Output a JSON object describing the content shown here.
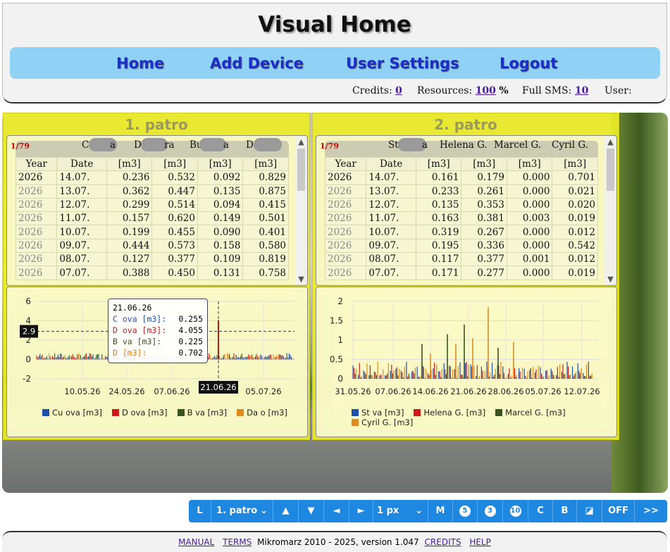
{
  "app_title": "Visual Home",
  "nav": {
    "home": "Home",
    "add_device": "Add Device",
    "user_settings": "User Settings",
    "logout": "Logout"
  },
  "stats": {
    "credits_label": "Credits:",
    "credits": "0",
    "resources_label": "Resources:",
    "resources": "100",
    "resources_unit": "%",
    "sms_label": "Full SMS:",
    "sms": "10",
    "user_label": "User:"
  },
  "panels": [
    {
      "title": "1. patro",
      "pager": "1/79",
      "columns": [
        "C",
        "a",
        "D",
        "ra",
        "Bu",
        "a",
        "D"
      ],
      "header_row": [
        "Year",
        "Date",
        "[m3]",
        "[m3]",
        "[m3]",
        "[m3]"
      ],
      "rows": [
        [
          "2026",
          "14.07.",
          "0.236",
          "0.532",
          "0.092",
          "0.829"
        ],
        [
          "2026",
          "13.07.",
          "0.362",
          "0.447",
          "0.135",
          "0.875"
        ],
        [
          "2026",
          "12.07.",
          "0.299",
          "0.514",
          "0.094",
          "0.415"
        ],
        [
          "2026",
          "11.07.",
          "0.157",
          "0.620",
          "0.149",
          "0.501"
        ],
        [
          "2026",
          "10.07.",
          "0.199",
          "0.455",
          "0.090",
          "0.401"
        ],
        [
          "2026",
          "09.07.",
          "0.444",
          "0.573",
          "0.158",
          "0.580"
        ],
        [
          "2026",
          "08.07.",
          "0.127",
          "0.377",
          "0.109",
          "0.819"
        ],
        [
          "2026",
          "07.07.",
          "0.388",
          "0.450",
          "0.131",
          "0.758"
        ]
      ],
      "tooltip": {
        "date": "21.06.26",
        "lines": [
          {
            "label": "C    ova [m3]:",
            "value": "0.255",
            "color": "#1f4fa8"
          },
          {
            "label": "D    ova [m3]:",
            "value": "4.055",
            "color": "#c02020"
          },
          {
            "label": "B    va [m3]:",
            "value": "0.225",
            "color": "#3b5320"
          },
          {
            "label": "D    [m3]:",
            "value": "0.702",
            "color": "#d98020"
          }
        ]
      },
      "crosshair_y_label": "2.9",
      "crosshair_x_label": "21.06.26",
      "legend": [
        {
          "name": "Cu    ova [m3]",
          "color": "#1f4fa8"
        },
        {
          "name": "D    ova [m3]",
          "color": "#d01a1a"
        },
        {
          "name": "B    va [m3]",
          "color": "#3b5320"
        },
        {
          "name": "Da    o [m3]",
          "color": "#e08a20"
        }
      ]
    },
    {
      "title": "2. patro",
      "pager": "1/79",
      "columns": [
        "St",
        "a",
        "Helena G.",
        "Marcel G.",
        "Cyril G."
      ],
      "header_row": [
        "Year",
        "Date",
        "[m3]",
        "[m3]",
        "[m3]",
        "[m3]"
      ],
      "rows": [
        [
          "2026",
          "14.07.",
          "0.161",
          "0.179",
          "0.000",
          "0.701"
        ],
        [
          "2026",
          "13.07.",
          "0.233",
          "0.261",
          "0.000",
          "0.021"
        ],
        [
          "2026",
          "12.07.",
          "0.135",
          "0.353",
          "0.000",
          "0.020"
        ],
        [
          "2026",
          "11.07.",
          "0.163",
          "0.381",
          "0.003",
          "0.019"
        ],
        [
          "2026",
          "10.07.",
          "0.319",
          "0.267",
          "0.000",
          "0.012"
        ],
        [
          "2026",
          "09.07.",
          "0.195",
          "0.336",
          "0.000",
          "0.542"
        ],
        [
          "2026",
          "08.07.",
          "0.117",
          "0.377",
          "0.001",
          "0.012"
        ],
        [
          "2026",
          "07.07.",
          "0.171",
          "0.277",
          "0.000",
          "0.019"
        ]
      ],
      "legend": [
        {
          "name": "St    va [m3]",
          "color": "#1f4fa8"
        },
        {
          "name": "Helena G. [m3]",
          "color": "#d01a1a"
        },
        {
          "name": "Marcel G. [m3]",
          "color": "#3b5320"
        },
        {
          "name": "Cyril G. [m3]",
          "color": "#e08a20"
        }
      ]
    }
  ],
  "chart_data": [
    {
      "type": "bar",
      "x_ticks": [
        "10.05.26",
        "24.05.26",
        "07.06.26",
        "21.06.26",
        "05.07.26"
      ],
      "y_ticks": [
        "6",
        "4",
        "2",
        "0",
        "-2"
      ],
      "ylim": [
        -2,
        6
      ],
      "series": [
        {
          "name": "Cu    ova [m3]",
          "approx_range": [
            0.1,
            0.45
          ]
        },
        {
          "name": "D    ova [m3]",
          "approx_range": [
            0.35,
            0.65
          ],
          "peak": {
            "x": "21.06.26",
            "value": 4.055
          }
        },
        {
          "name": "B    va [m3]",
          "approx_range": [
            0.09,
            0.16
          ]
        },
        {
          "name": "Da    o [m3]",
          "approx_range": [
            0.4,
            0.88
          ]
        }
      ]
    },
    {
      "type": "bar",
      "x_ticks": [
        "31.05.26",
        "07.06.26",
        "14.06.26",
        "21.06.26",
        "28.06.26",
        "05.07.26",
        "12.07.26"
      ],
      "y_ticks": [
        "2",
        "1.5",
        "1",
        "0.5",
        "0"
      ],
      "ylim": [
        0,
        2
      ],
      "series": [
        {
          "name": "St    va [m3]",
          "approx_range": [
            0.1,
            0.35
          ]
        },
        {
          "name": "Helena G. [m3]",
          "approx_range": [
            0.17,
            0.4
          ]
        },
        {
          "name": "Marcel G. [m3]",
          "peaks": [
            1.4,
            1.1
          ]
        },
        {
          "name": "Cyril G. [m3]",
          "peaks": [
            1.85,
            0.7
          ]
        }
      ]
    }
  ],
  "toolbar": {
    "l": "L",
    "select_floor": "1. patro",
    "up": "▲",
    "down": "▼",
    "left": "◄",
    "right": "►",
    "select_px": "1 px",
    "m": "M",
    "five": "5",
    "three": "3",
    "ten": "10",
    "c": "C",
    "b": "B",
    "resize": "◪",
    "off": "OFF",
    "next": ">>"
  },
  "footer": {
    "manual": "MANUAL",
    "terms": "TERMS",
    "copyright": "Mikromarz 2010 - 2025, version 1.047",
    "credits": "CREDITS",
    "help": "HELP"
  }
}
